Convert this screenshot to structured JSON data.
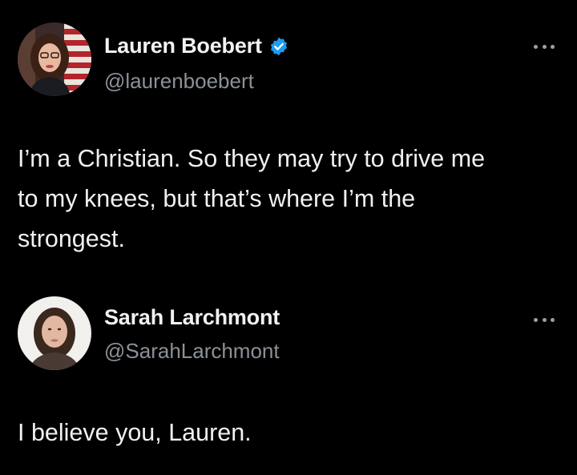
{
  "tweets": [
    {
      "display_name": "Lauren Boebert",
      "handle": "@laurenboebert",
      "verified": true,
      "avatar_icon": "profile-photo-woman-flag-background",
      "more_icon": "more-options-icon",
      "text_lines": [
        "I’m a Christian. So they may try to drive me",
        "to my knees, but that’s where I’m the",
        "strongest."
      ]
    },
    {
      "display_name": "Sarah Larchmont",
      "handle": "@SarahLarchmont",
      "verified": false,
      "avatar_icon": "profile-photo-woman",
      "more_icon": "more-options-icon",
      "text_lines": [
        "I believe you, Lauren."
      ]
    }
  ],
  "colors": {
    "background": "#000000",
    "text": "#e7e9ea",
    "secondary_text": "#8b9197",
    "verified_badge": "#1d9bf0"
  }
}
